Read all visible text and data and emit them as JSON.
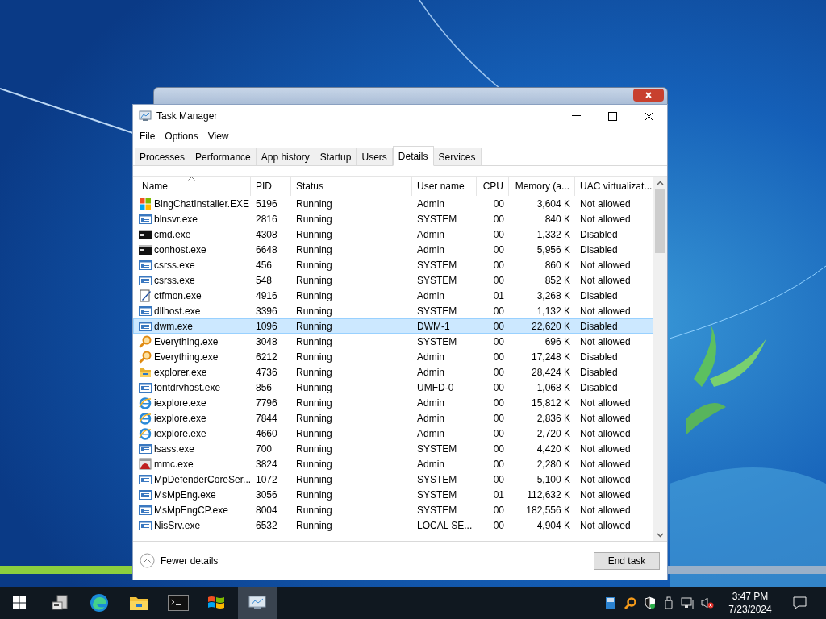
{
  "window": {
    "title": "Task Manager"
  },
  "menu": [
    "File",
    "Options",
    "View"
  ],
  "tabs": [
    {
      "label": "Processes",
      "selected": false
    },
    {
      "label": "Performance",
      "selected": false
    },
    {
      "label": "App history",
      "selected": false
    },
    {
      "label": "Startup",
      "selected": false
    },
    {
      "label": "Users",
      "selected": false
    },
    {
      "label": "Details",
      "selected": true
    },
    {
      "label": "Services",
      "selected": false
    }
  ],
  "table": {
    "columns": [
      "Name",
      "PID",
      "Status",
      "User name",
      "CPU",
      "Memory (a...",
      "UAC virtualizat..."
    ],
    "rows": [
      {
        "kind": "windows",
        "name": "BingChatInstaller.EXE",
        "pid": "5196",
        "status": "Running",
        "user": "Admin",
        "cpu": "00",
        "memory": "3,604 K",
        "uac": "Not allowed",
        "selected": false
      },
      {
        "kind": "app",
        "name": "blnsvr.exe",
        "pid": "2816",
        "status": "Running",
        "user": "SYSTEM",
        "cpu": "00",
        "memory": "840 K",
        "uac": "Not allowed",
        "selected": false
      },
      {
        "kind": "console",
        "name": "cmd.exe",
        "pid": "4308",
        "status": "Running",
        "user": "Admin",
        "cpu": "00",
        "memory": "1,332 K",
        "uac": "Disabled",
        "selected": false
      },
      {
        "kind": "console",
        "name": "conhost.exe",
        "pid": "6648",
        "status": "Running",
        "user": "Admin",
        "cpu": "00",
        "memory": "5,956 K",
        "uac": "Disabled",
        "selected": false
      },
      {
        "kind": "app",
        "name": "csrss.exe",
        "pid": "456",
        "status": "Running",
        "user": "SYSTEM",
        "cpu": "00",
        "memory": "860 K",
        "uac": "Not allowed",
        "selected": false
      },
      {
        "kind": "app",
        "name": "csrss.exe",
        "pid": "548",
        "status": "Running",
        "user": "SYSTEM",
        "cpu": "00",
        "memory": "852 K",
        "uac": "Not allowed",
        "selected": false
      },
      {
        "kind": "notepad",
        "name": "ctfmon.exe",
        "pid": "4916",
        "status": "Running",
        "user": "Admin",
        "cpu": "01",
        "memory": "3,268 K",
        "uac": "Disabled",
        "selected": false
      },
      {
        "kind": "app",
        "name": "dllhost.exe",
        "pid": "3396",
        "status": "Running",
        "user": "SYSTEM",
        "cpu": "00",
        "memory": "1,132 K",
        "uac": "Not allowed",
        "selected": false
      },
      {
        "kind": "app",
        "name": "dwm.exe",
        "pid": "1096",
        "status": "Running",
        "user": "DWM-1",
        "cpu": "00",
        "memory": "22,620 K",
        "uac": "Disabled",
        "selected": true
      },
      {
        "kind": "search",
        "name": "Everything.exe",
        "pid": "3048",
        "status": "Running",
        "user": "SYSTEM",
        "cpu": "00",
        "memory": "696 K",
        "uac": "Not allowed",
        "selected": false
      },
      {
        "kind": "search",
        "name": "Everything.exe",
        "pid": "6212",
        "status": "Running",
        "user": "Admin",
        "cpu": "00",
        "memory": "17,248 K",
        "uac": "Disabled",
        "selected": false
      },
      {
        "kind": "folder",
        "name": "explorer.exe",
        "pid": "4736",
        "status": "Running",
        "user": "Admin",
        "cpu": "00",
        "memory": "28,424 K",
        "uac": "Disabled",
        "selected": false
      },
      {
        "kind": "app",
        "name": "fontdrvhost.exe",
        "pid": "856",
        "status": "Running",
        "user": "UMFD-0",
        "cpu": "00",
        "memory": "1,068 K",
        "uac": "Disabled",
        "selected": false
      },
      {
        "kind": "ie",
        "name": "iexplore.exe",
        "pid": "7796",
        "status": "Running",
        "user": "Admin",
        "cpu": "00",
        "memory": "15,812 K",
        "uac": "Not allowed",
        "selected": false
      },
      {
        "kind": "ie",
        "name": "iexplore.exe",
        "pid": "7844",
        "status": "Running",
        "user": "Admin",
        "cpu": "00",
        "memory": "2,836 K",
        "uac": "Not allowed",
        "selected": false
      },
      {
        "kind": "ie",
        "name": "iexplore.exe",
        "pid": "4660",
        "status": "Running",
        "user": "Admin",
        "cpu": "00",
        "memory": "2,720 K",
        "uac": "Not allowed",
        "selected": false
      },
      {
        "kind": "app",
        "name": "lsass.exe",
        "pid": "700",
        "status": "Running",
        "user": "SYSTEM",
        "cpu": "00",
        "memory": "4,420 K",
        "uac": "Not allowed",
        "selected": false
      },
      {
        "kind": "mmc",
        "name": "mmc.exe",
        "pid": "3824",
        "status": "Running",
        "user": "Admin",
        "cpu": "00",
        "memory": "2,280 K",
        "uac": "Not allowed",
        "selected": false
      },
      {
        "kind": "app",
        "name": "MpDefenderCoreSer...",
        "pid": "1072",
        "status": "Running",
        "user": "SYSTEM",
        "cpu": "00",
        "memory": "5,100 K",
        "uac": "Not allowed",
        "selected": false
      },
      {
        "kind": "app",
        "name": "MsMpEng.exe",
        "pid": "3056",
        "status": "Running",
        "user": "SYSTEM",
        "cpu": "01",
        "memory": "112,632 K",
        "uac": "Not allowed",
        "selected": false
      },
      {
        "kind": "app",
        "name": "MsMpEngCP.exe",
        "pid": "8004",
        "status": "Running",
        "user": "SYSTEM",
        "cpu": "00",
        "memory": "182,556 K",
        "uac": "Not allowed",
        "selected": false
      },
      {
        "kind": "app",
        "name": "NisSrv.exe",
        "pid": "6532",
        "status": "Running",
        "user": "LOCAL SE...",
        "cpu": "00",
        "memory": "4,904 K",
        "uac": "Not allowed",
        "selected": false
      }
    ]
  },
  "footer": {
    "toggle": "Fewer details",
    "button": "End task"
  },
  "taskbar": {
    "time": "3:47 PM",
    "date": "7/23/2024"
  }
}
